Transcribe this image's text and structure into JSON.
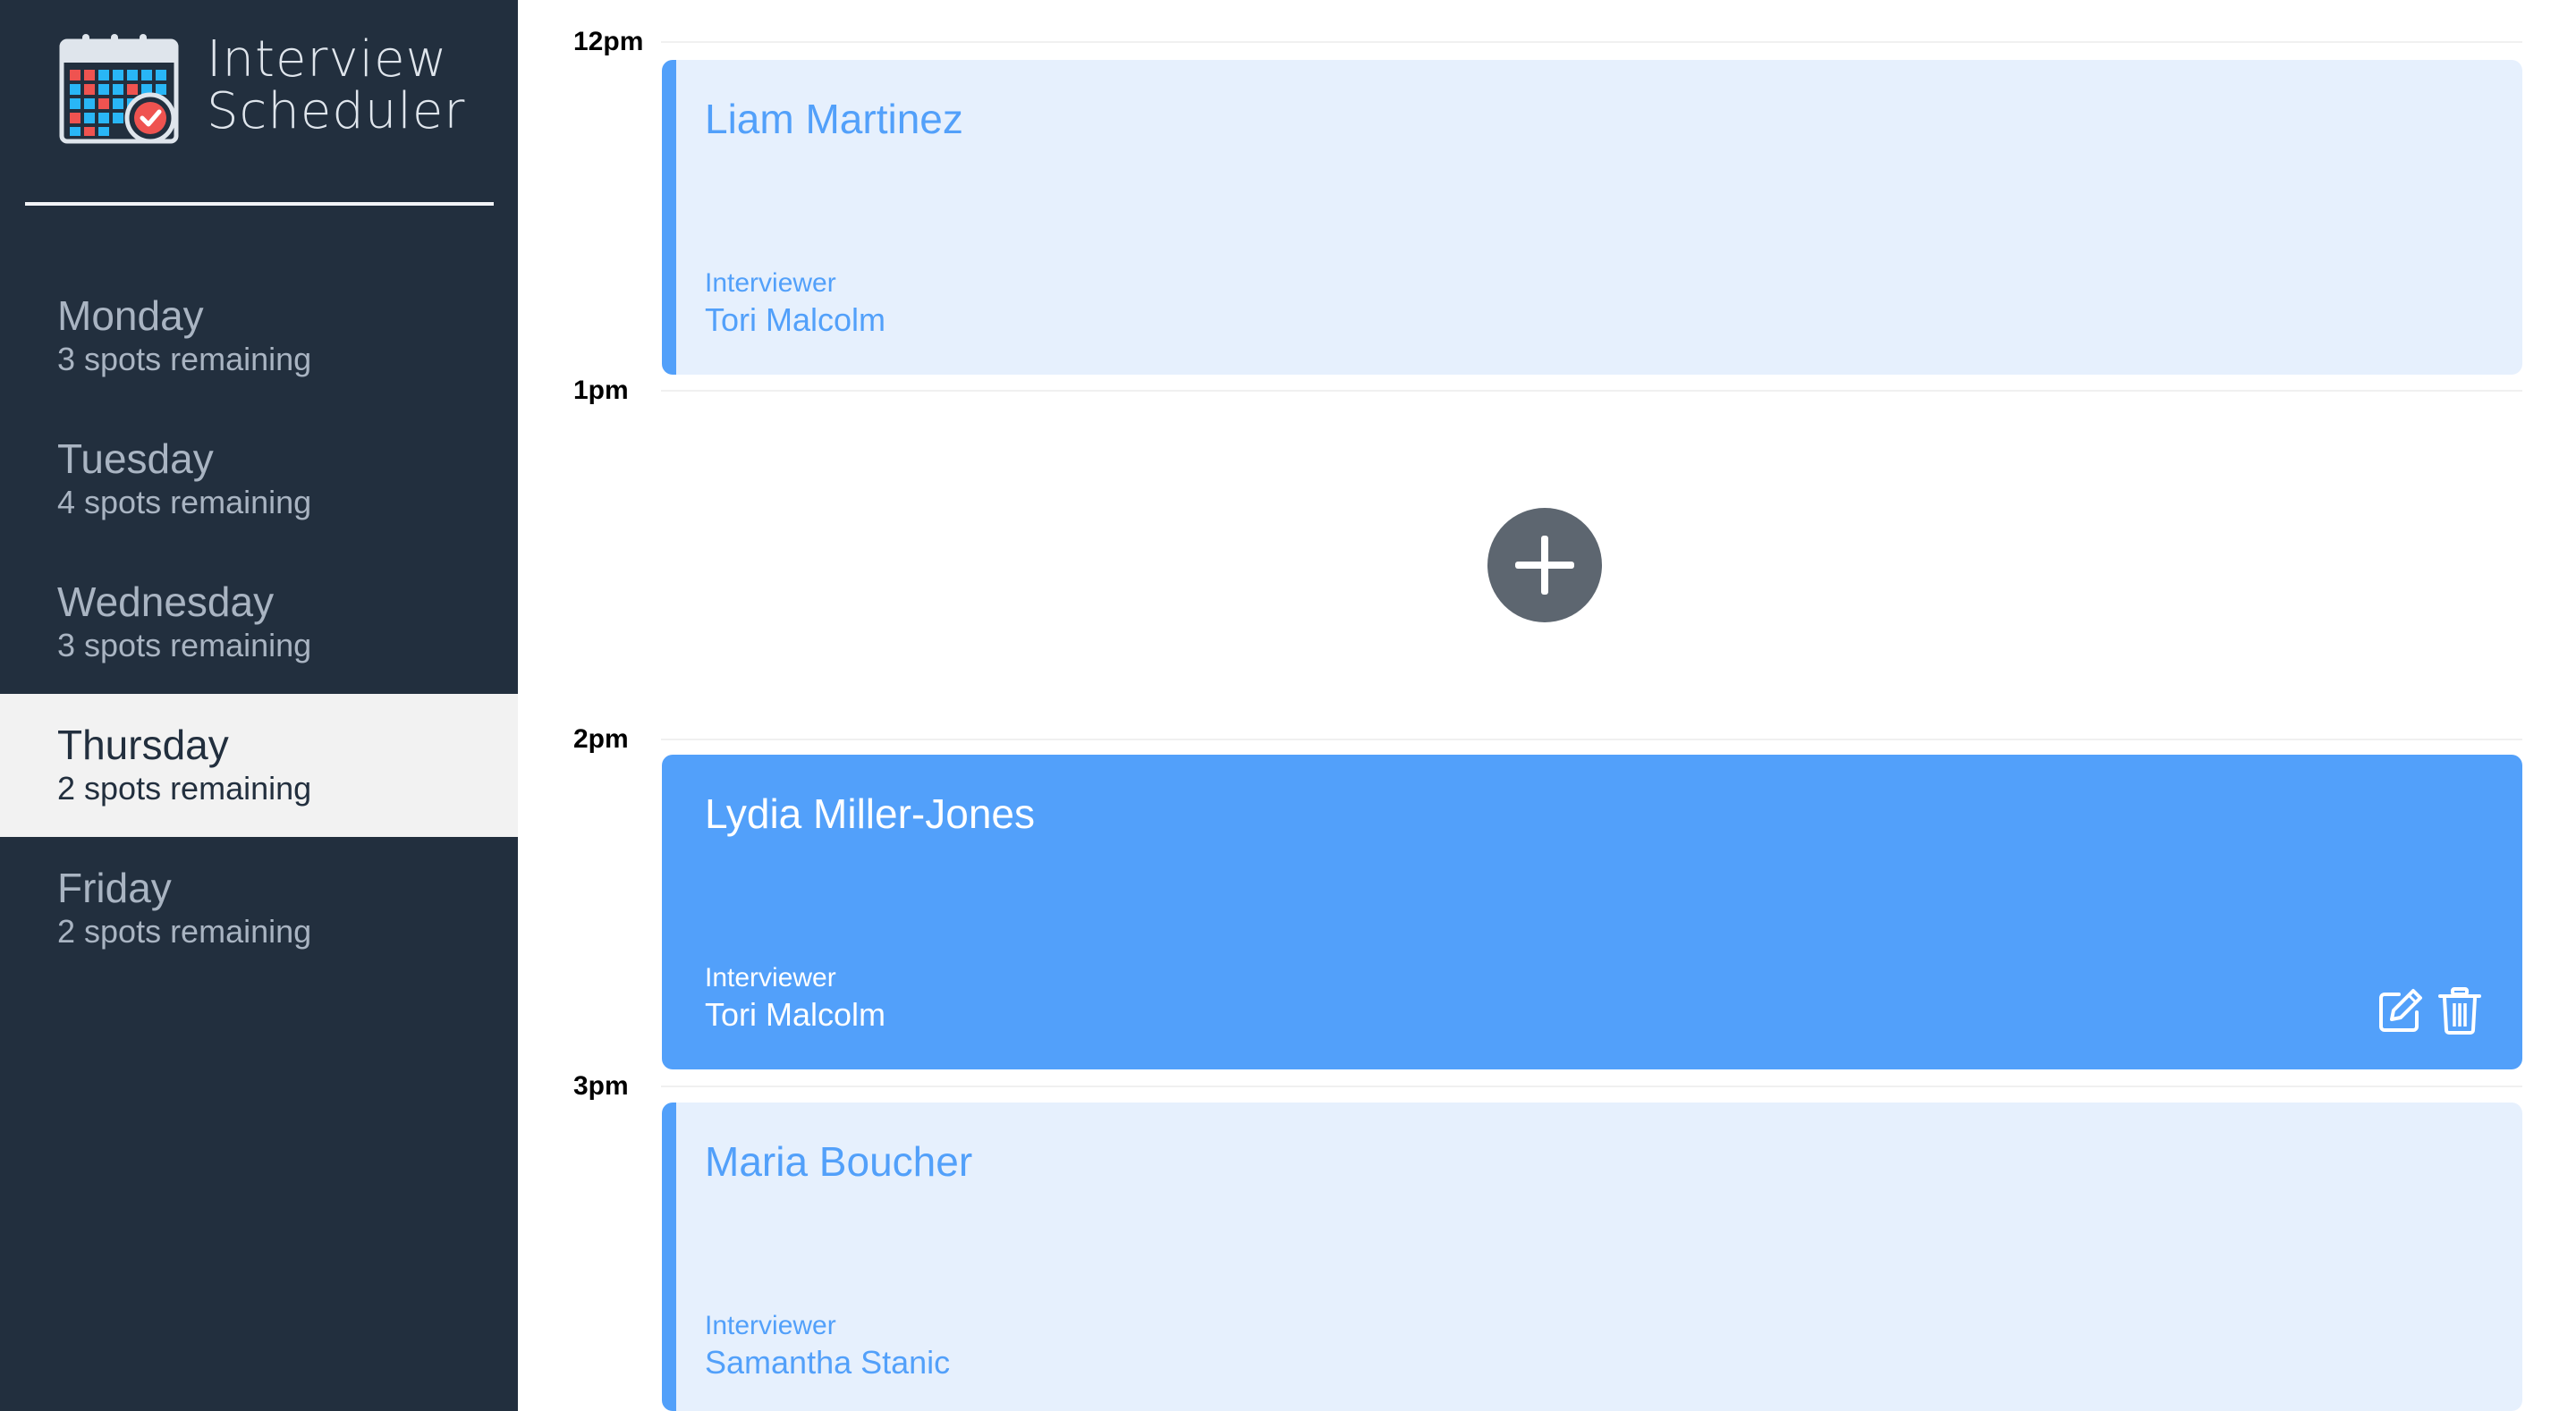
{
  "app": {
    "title_line1": "Interview",
    "title_line2": "Scheduler"
  },
  "sidebar": {
    "days": [
      {
        "name": "Monday",
        "spots": "3 spots remaining",
        "selected": false
      },
      {
        "name": "Tuesday",
        "spots": "4 spots remaining",
        "selected": false
      },
      {
        "name": "Wednesday",
        "spots": "3 spots remaining",
        "selected": false
      },
      {
        "name": "Thursday",
        "spots": "2 spots remaining",
        "selected": true
      },
      {
        "name": "Friday",
        "spots": "2 spots remaining",
        "selected": false
      }
    ]
  },
  "schedule": {
    "times": [
      "12pm",
      "1pm",
      "2pm",
      "3pm"
    ],
    "appointments": [
      {
        "student": "Liam Martinez",
        "interviewer_label": "Interviewer",
        "interviewer": "Tori Malcolm",
        "state": "normal"
      },
      {
        "empty": true,
        "add_icon": "plus-icon"
      },
      {
        "student": "Lydia Miller-Jones",
        "interviewer_label": "Interviewer",
        "interviewer": "Tori Malcolm",
        "state": "hover",
        "actions": [
          "edit-icon",
          "trash-icon"
        ]
      },
      {
        "student": "Maria Boucher",
        "interviewer_label": "Interviewer",
        "interviewer": "Samantha Stanic",
        "state": "normal"
      }
    ]
  },
  "colors": {
    "sidebar_bg": "#222f3e",
    "selected_day_bg": "#f2f2f2",
    "appointment_light_bg": "#e6f0fd",
    "appointment_accent": "#52a0fa",
    "add_button": "#5d6670"
  }
}
